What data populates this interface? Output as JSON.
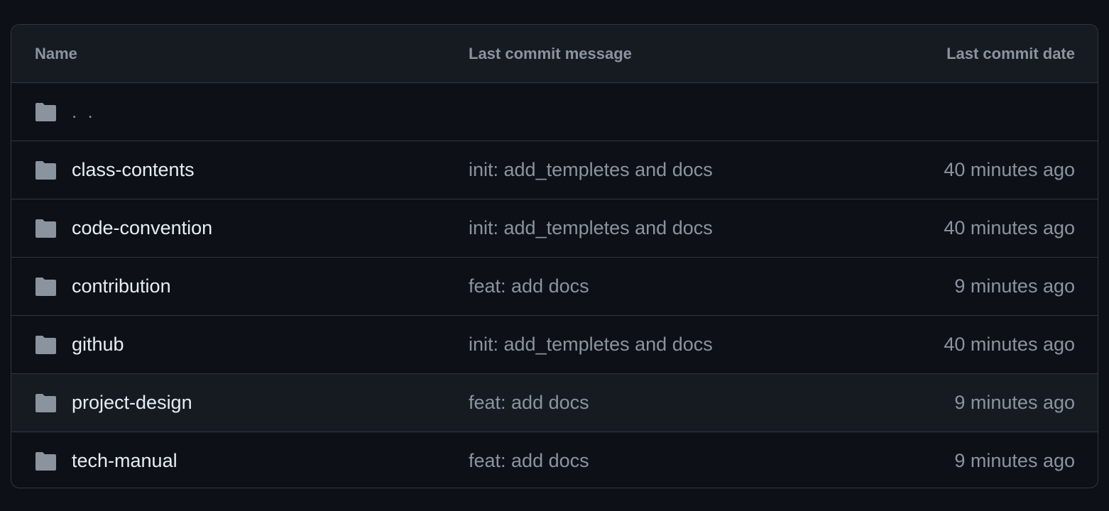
{
  "table": {
    "headers": {
      "name": "Name",
      "message": "Last commit message",
      "date": "Last commit date"
    },
    "parent": {
      "label": ". ."
    },
    "rows": [
      {
        "name": "class-contents",
        "message": "init: add_templetes and docs",
        "date": "40 minutes ago"
      },
      {
        "name": "code-convention",
        "message": "init: add_templetes and docs",
        "date": "40 minutes ago"
      },
      {
        "name": "contribution",
        "message": "feat: add docs",
        "date": "9 minutes ago"
      },
      {
        "name": "github",
        "message": "init: add_templetes and docs",
        "date": "40 minutes ago"
      },
      {
        "name": "project-design",
        "message": "feat: add docs",
        "date": "9 minutes ago"
      },
      {
        "name": "tech-manual",
        "message": "feat: add docs",
        "date": "9 minutes ago"
      }
    ],
    "icon": "folder-icon",
    "colors": {
      "background": "#0d1117",
      "header_background": "#161b22",
      "border": "#30363d",
      "primary_text": "#e6edf3",
      "muted_text": "#8b949e",
      "folder": "#8b949e"
    }
  }
}
